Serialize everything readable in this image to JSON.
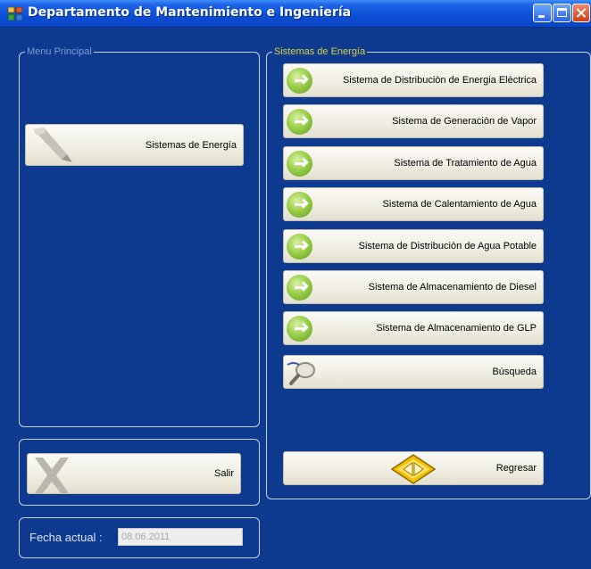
{
  "window": {
    "title": "Departamento de Mantenimiento e Ingeniería"
  },
  "menu_principal": {
    "legend": "Menu Principal",
    "energy_button": "Sistemas de Energía"
  },
  "sistemas_panel": {
    "legend": "Sistemas de Energía",
    "items": [
      {
        "label": "Sistema de Distribuciòn de Energia Elèctrica",
        "icon": "green-arrow-icon"
      },
      {
        "label": "Sistema de Generaciòn de Vapor",
        "icon": "green-arrow-icon"
      },
      {
        "label": "Sistema de Tratamiento de Agua",
        "icon": "green-arrow-icon"
      },
      {
        "label": "Sistema de Calentamiento de Agua",
        "icon": "green-arrow-icon"
      },
      {
        "label": "Sistema de Distribuciòn de Agua Potable",
        "icon": "green-arrow-icon"
      },
      {
        "label": "Sistema de Almacenamiento de Diesel",
        "icon": "green-arrow-icon"
      },
      {
        "label": "Sistema de Almacenamiento de GLP",
        "icon": "green-arrow-icon"
      }
    ],
    "search_label": "Búsqueda",
    "back_label": "Regresar"
  },
  "salir_label": "Salir",
  "fecha": {
    "label": "Fecha actual :",
    "value": "08.06.2011"
  },
  "colors": {
    "background": "#0d3a8e",
    "titlebar": "#0c4fd6",
    "button_face": "#f0eee2",
    "accent_green": "#9bcf49"
  }
}
